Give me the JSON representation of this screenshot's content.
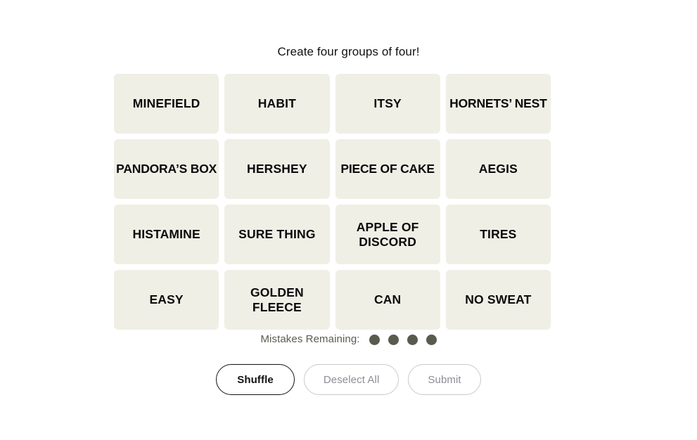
{
  "title": "Create four groups of four!",
  "grid": {
    "tiles": [
      {
        "label": "MINEFIELD",
        "wide": false
      },
      {
        "label": "HABIT",
        "wide": false
      },
      {
        "label": "ITSY",
        "wide": false
      },
      {
        "label": "HORNETS’ NEST",
        "wide": true
      },
      {
        "label": "PANDORA’S BOX",
        "wide": true
      },
      {
        "label": "HERSHEY",
        "wide": false
      },
      {
        "label": "PIECE OF CAKE",
        "wide": true
      },
      {
        "label": "AEGIS",
        "wide": false
      },
      {
        "label": "HISTAMINE",
        "wide": false
      },
      {
        "label": "SURE THING",
        "wide": false
      },
      {
        "label": "APPLE OF\nDISCORD",
        "wide": false
      },
      {
        "label": "TIRES",
        "wide": false
      },
      {
        "label": "EASY",
        "wide": false
      },
      {
        "label": "GOLDEN\nFLEECE",
        "wide": false
      },
      {
        "label": "CAN",
        "wide": false
      },
      {
        "label": "NO SWEAT",
        "wide": false
      }
    ]
  },
  "mistakes": {
    "label": "Mistakes Remaining:",
    "remaining": 4,
    "dot_color": "#5a5a4e"
  },
  "buttons": [
    {
      "label": "Shuffle",
      "state": "enabled",
      "name": "shuffle-button"
    },
    {
      "label": "Deselect All",
      "state": "disabled",
      "name": "deselect-all-button"
    },
    {
      "label": "Submit",
      "state": "disabled",
      "name": "submit-button"
    }
  ],
  "colors": {
    "page_background": "#ffffff",
    "tile_background": "#EFEFE6",
    "tile_text": "#0b0b0b",
    "disabled_text": "#8d8d94",
    "disabled_border": "#cacaca"
  }
}
